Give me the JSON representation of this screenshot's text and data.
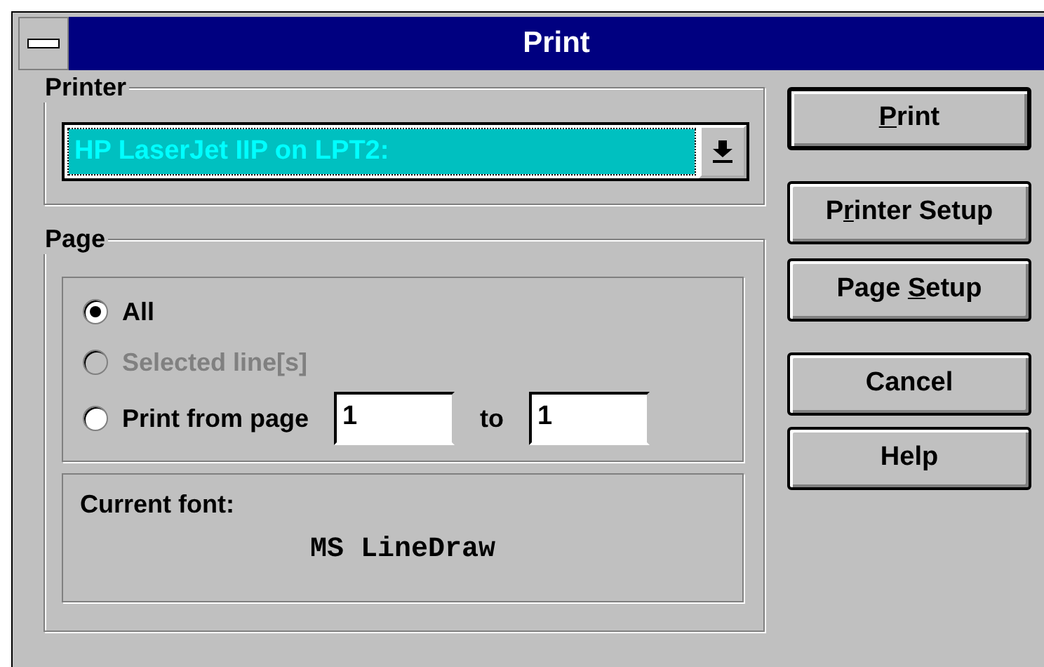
{
  "window": {
    "title": "Print"
  },
  "printer": {
    "label": "Printer",
    "value": "HP LaserJet IIP on LPT2:"
  },
  "page": {
    "label": "Page",
    "options": [
      {
        "kind": "radio",
        "label": "All",
        "selected": true,
        "disabled": false
      },
      {
        "kind": "radio",
        "label": "Selected line[s]",
        "selected": false,
        "disabled": true
      },
      {
        "kind": "range",
        "label": "Print from page",
        "selected": false,
        "disabled": false,
        "from": "1",
        "to_label": "to",
        "to": "1"
      }
    ],
    "font_label": "Current font:",
    "font_value": "MS LineDraw"
  },
  "buttons": [
    {
      "mnemonic": "P",
      "after": "rint",
      "default": true
    },
    {
      "before": "P",
      "mnemonic": "r",
      "after": "inter Setup",
      "default": false
    },
    {
      "before": "Page ",
      "mnemonic": "S",
      "after": "etup",
      "default": false
    },
    {
      "before": "Cancel",
      "default": false
    },
    {
      "before": "Help",
      "default": false
    }
  ]
}
